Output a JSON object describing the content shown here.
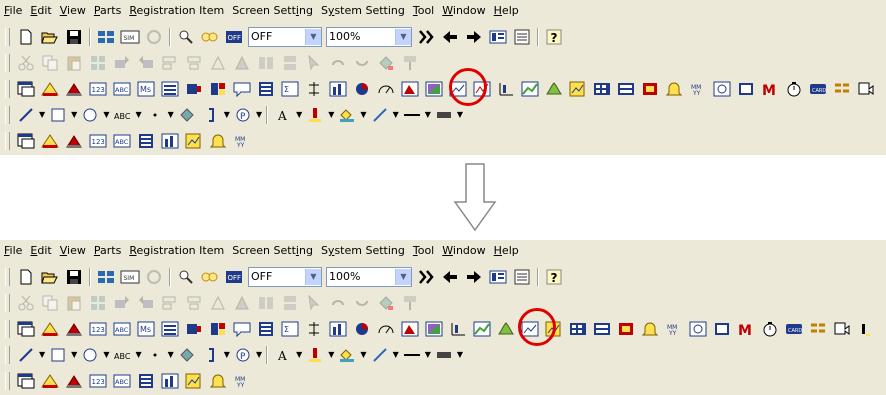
{
  "menu": [
    {
      "u": "F",
      "rest": "ile"
    },
    {
      "u": "E",
      "rest": "dit"
    },
    {
      "u": "V",
      "rest": "iew"
    },
    {
      "u": "P",
      "rest": "arts"
    },
    {
      "u": "R",
      "rest": "egistration Item"
    },
    {
      "pre": "Screen Sett",
      "u": "i",
      "rest": "ng"
    },
    {
      "pre": "S",
      "u": "y",
      "rest": "stem Setting"
    },
    {
      "u": "T",
      "rest": "ool"
    },
    {
      "u": "W",
      "rest": "indow"
    },
    {
      "u": "H",
      "rest": "elp"
    }
  ],
  "toolbar": {
    "layer_value": "OFF",
    "zoom_value": "100%"
  },
  "colors": {
    "toolbar_bg": "#ece9d8",
    "highlight": "#e00000"
  },
  "icons": {
    "highlighted": "trend-graph-icon"
  }
}
